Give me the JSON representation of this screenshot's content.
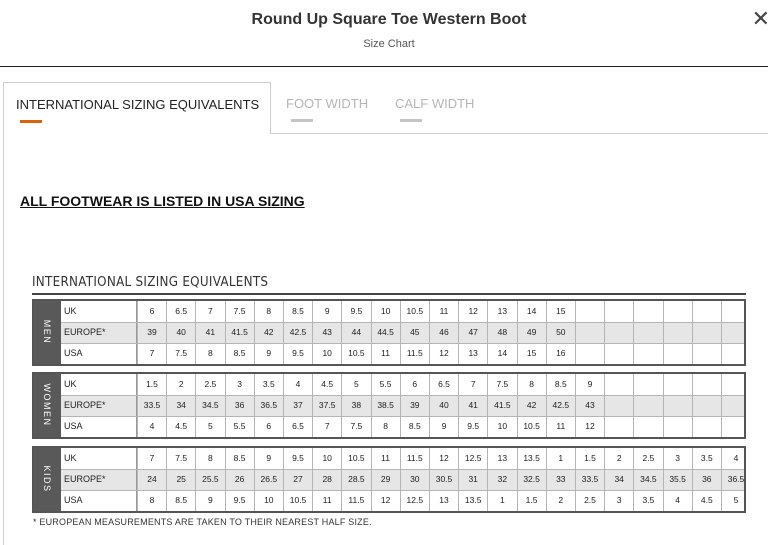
{
  "header": {
    "title": "Round Up Square Toe Western Boot",
    "subtitle": "Size Chart",
    "close_glyph": "✕"
  },
  "tabs": [
    {
      "label": "INTERNATIONAL SIZING EQUIVALENTS",
      "active": true
    },
    {
      "label": "FOOT WIDTH",
      "active": false
    },
    {
      "label": "CALF WIDTH",
      "active": false
    }
  ],
  "notice": "ALL FOOTWEAR IS LISTED IN USA SIZING",
  "chart_title": "INTERNATIONAL SIZING EQUIVALENTS",
  "colors": {
    "accent": "#d8640f",
    "inactive_tab": "#b5b5b5",
    "side_band": "#595959"
  },
  "groups": [
    {
      "name": "MEN",
      "rows": [
        {
          "label": "UK",
          "values": [
            "6",
            "6.5",
            "7",
            "7.5",
            "8",
            "8.5",
            "9",
            "9.5",
            "10",
            "10.5",
            "11",
            "12",
            "13",
            "14",
            "15",
            "",
            "",
            "",
            "",
            "",
            ""
          ]
        },
        {
          "label": "EUROPE*",
          "values": [
            "39",
            "40",
            "41",
            "41.5",
            "42",
            "42.5",
            "43",
            "44",
            "44.5",
            "45",
            "46",
            "47",
            "48",
            "49",
            "50",
            "",
            "",
            "",
            "",
            "",
            ""
          ]
        },
        {
          "label": "USA",
          "values": [
            "7",
            "7.5",
            "8",
            "8.5",
            "9",
            "9.5",
            "10",
            "10.5",
            "11",
            "11.5",
            "12",
            "13",
            "14",
            "15",
            "16",
            "",
            "",
            "",
            "",
            "",
            ""
          ]
        }
      ]
    },
    {
      "name": "WOMEN",
      "rows": [
        {
          "label": "UK",
          "values": [
            "1.5",
            "2",
            "2.5",
            "3",
            "3.5",
            "4",
            "4.5",
            "5",
            "5.5",
            "6",
            "6.5",
            "7",
            "7.5",
            "8",
            "8.5",
            "9",
            "",
            "",
            "",
            "",
            ""
          ]
        },
        {
          "label": "EUROPE*",
          "values": [
            "33.5",
            "34",
            "34.5",
            "36",
            "36.5",
            "37",
            "37.5",
            "38",
            "38.5",
            "39",
            "40",
            "41",
            "41.5",
            "42",
            "42.5",
            "43",
            "",
            "",
            "",
            "",
            ""
          ]
        },
        {
          "label": "USA",
          "values": [
            "4",
            "4.5",
            "5",
            "5.5",
            "6",
            "6.5",
            "7",
            "7.5",
            "8",
            "8.5",
            "9",
            "9.5",
            "10",
            "10.5",
            "11",
            "12",
            "",
            "",
            "",
            "",
            ""
          ]
        }
      ]
    },
    {
      "name": "KIDS",
      "rows": [
        {
          "label": "UK",
          "values": [
            "7",
            "7.5",
            "8",
            "8.5",
            "9",
            "9.5",
            "10",
            "10.5",
            "11",
            "11.5",
            "12",
            "12.5",
            "13",
            "13.5",
            "1",
            "1.5",
            "2",
            "2.5",
            "3",
            "3.5",
            "4"
          ]
        },
        {
          "label": "EUROPE*",
          "values": [
            "24",
            "25",
            "25.5",
            "26",
            "26.5",
            "27",
            "28",
            "28.5",
            "29",
            "30",
            "30.5",
            "31",
            "32",
            "32.5",
            "33",
            "33.5",
            "34",
            "34.5",
            "35.5",
            "36",
            "36.5"
          ]
        },
        {
          "label": "USA",
          "values": [
            "8",
            "8.5",
            "9",
            "9.5",
            "10",
            "10.5",
            "11",
            "11.5",
            "12",
            "12.5",
            "13",
            "13.5",
            "1",
            "1.5",
            "2",
            "2.5",
            "3",
            "3.5",
            "4",
            "4.5",
            "5"
          ]
        }
      ]
    }
  ],
  "footnote": "* EUROPEAN MEASUREMENTS ARE TAKEN TO THEIR NEAREST HALF SIZE."
}
